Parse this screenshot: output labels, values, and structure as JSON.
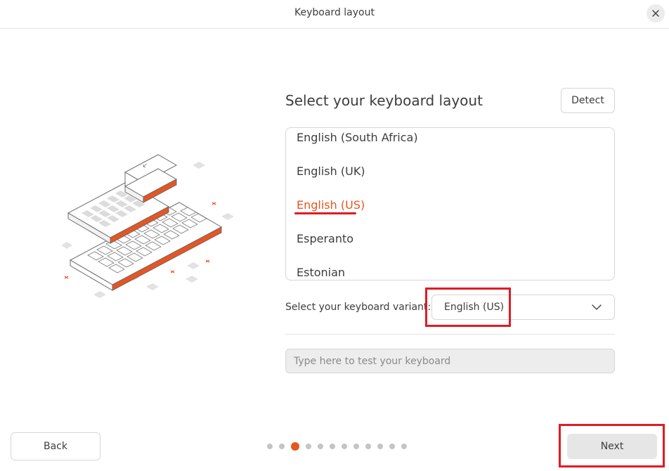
{
  "window": {
    "title": "Keyboard layout"
  },
  "main": {
    "heading": "Select your keyboard layout",
    "detect_label": "Detect",
    "layouts": [
      {
        "label": "English (South Africa)",
        "selected": false
      },
      {
        "label": "English (UK)",
        "selected": false
      },
      {
        "label": "English (US)",
        "selected": true
      },
      {
        "label": "Esperanto",
        "selected": false
      },
      {
        "label": "Estonian",
        "selected": false
      }
    ],
    "variant_label": "Select your keyboard variant:",
    "variant_value": "English (US)",
    "test_placeholder": "Type here to test your keyboard"
  },
  "footer": {
    "back_label": "Back",
    "next_label": "Next",
    "page_count": 12,
    "current_page": 3
  },
  "colors": {
    "accent": "#e95420",
    "annotation_red": "#e01b24"
  },
  "icons": {
    "close": "close-icon",
    "chevron": "chevron-down-icon",
    "illustration": "keyboard-illustration"
  }
}
